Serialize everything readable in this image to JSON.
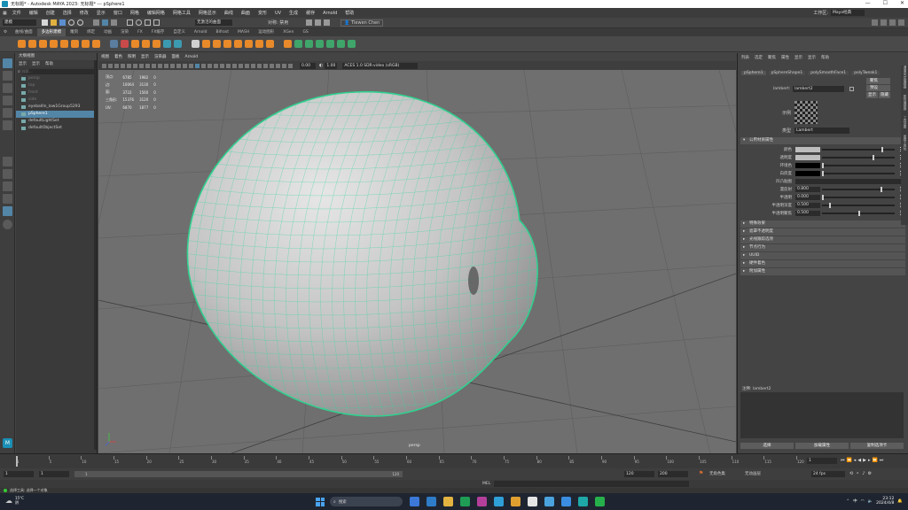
{
  "window": {
    "title": "无标题* - Autodesk MAYA 2023: 无标题* --- pSphere1",
    "controls": [
      "—",
      "☐",
      "✕"
    ]
  },
  "menubar": {
    "items": [
      "文件",
      "编辑",
      "创建",
      "选择",
      "修改",
      "显示",
      "窗口",
      "网格",
      "编辑网格",
      "网格工具",
      "网格显示",
      "曲线",
      "曲面",
      "变形",
      "UV",
      "生成",
      "缓存",
      "Arnold",
      "帮助"
    ],
    "workspace_label": "工作区:",
    "workspace_value": "Maya经典"
  },
  "statusline": {
    "mode": "建模",
    "no_live": "无激活的曲面",
    "symmetry": "对称: 禁用",
    "user": "Tiewen Chen"
  },
  "shelf": {
    "tabs": [
      "曲线/曲面",
      "多边形建模",
      "雕刻",
      "绑定",
      "动画",
      "渲染",
      "FX",
      "FX缓存",
      "自定义",
      "Arnold",
      "Bifrost",
      "MASH",
      "运动图形",
      "XGen",
      "GS"
    ],
    "active_tab": 1,
    "colors": [
      "#e8892a",
      "#e8892a",
      "#e8892a",
      "#e8892a",
      "#e8892a",
      "#e8892a",
      "#e8892a",
      "#e8892a",
      "#5a7da0",
      "#c94a4a",
      "#e8892a",
      "#e8892a",
      "#e8892a",
      "#3c9ab0",
      "#3c9ab0",
      "#d0d0d0",
      "#e8892a",
      "#e8892a",
      "#e8892a",
      "#e8892a",
      "#e8892a",
      "#e8892a",
      "#e8892a",
      "#e8892a",
      "#3fa56a",
      "#3fa56a",
      "#3fa56a",
      "#3fa56a",
      "#3fa56a",
      "#3fa56a"
    ]
  },
  "outliner": {
    "title": "大纲视图",
    "menu": [
      "显示",
      "显示",
      "帮助"
    ],
    "search_placeholder": "搜索...",
    "items": [
      {
        "label": "persp",
        "state": "dim"
      },
      {
        "label": "top",
        "state": "dim"
      },
      {
        "label": "front",
        "state": "dim"
      },
      {
        "label": "side",
        "state": "dim"
      },
      {
        "label": "eyeballIn_low1Group5293",
        "state": "normal"
      },
      {
        "label": "pSphere1",
        "state": "selected"
      },
      {
        "label": "defaultLightSet",
        "state": "normal"
      },
      {
        "label": "defaultObjectSet",
        "state": "normal"
      }
    ]
  },
  "viewport": {
    "menu": [
      "视图",
      "着色",
      "照明",
      "显示",
      "渲染器",
      "面板",
      "Arnold"
    ],
    "field_a": "0.00",
    "field_b": "1.00",
    "colorspace": "ACES 1.0 SDR-video (sRGB)",
    "camera_label": "persp",
    "hud": {
      "rows": [
        {
          "label": "顶点:",
          "v1": "6785",
          "v2": "1982",
          "v3": "0"
        },
        {
          "label": "边:",
          "v1": "10064",
          "v2": "3130",
          "v3": "0"
        },
        {
          "label": "面:",
          "v1": "3722",
          "v2": "1560",
          "v3": "0"
        },
        {
          "label": "三角形:",
          "v1": "15376",
          "v2": "3120",
          "v3": "0"
        },
        {
          "label": "UV:",
          "v1": "6870",
          "v2": "1877",
          "v3": "0"
        }
      ]
    }
  },
  "attribute_editor": {
    "menu": [
      "列表",
      "选定",
      "聚焦",
      "属性",
      "显示",
      "显示",
      "帮助"
    ],
    "tabs": [
      "pSphere1",
      "pSphereShape1",
      "polySmoothFace1",
      "polyTweak1"
    ],
    "node_label": "lambert:",
    "node_value": "lambert2",
    "buttons": [
      "聚焦",
      "预设",
      "显示",
      "隐藏"
    ],
    "sample_label": "示例",
    "type_label": "类型",
    "type_value": "Lambert",
    "section_open": "公用材质属性",
    "attrs": [
      {
        "label": "颜色",
        "kind": "swatch",
        "color": "#bdbdbd",
        "slider": 0.82
      },
      {
        "label": "透明度",
        "kind": "swatch",
        "color": "#bdbdbd",
        "slider": 0.7
      },
      {
        "label": "环境色",
        "kind": "swatch",
        "color": "#000000",
        "slider": 0.0
      },
      {
        "label": "白炽度",
        "kind": "swatch",
        "color": "#000000",
        "slider": 0.0
      },
      {
        "label": "凹凸贴图",
        "kind": "empty"
      },
      {
        "label": "漫反射",
        "kind": "value",
        "value": "0.800",
        "slider": 0.8
      },
      {
        "label": "半透明",
        "kind": "value",
        "value": "0.000",
        "slider": 0.0
      },
      {
        "label": "半透明深度",
        "kind": "value",
        "value": "0.500",
        "slider": 0.1
      },
      {
        "label": "半透明聚焦",
        "kind": "value",
        "value": "0.500",
        "slider": 0.5
      }
    ],
    "sections": [
      "特殊效果",
      "遮罩不透明度",
      "光线跟踪选项",
      "节点行为",
      "UUID",
      "硬件着色",
      "附加属性"
    ],
    "notes_label": "注释: lambert2",
    "bottom_buttons": [
      "选择",
      "加载属性",
      "复制选项卡"
    ],
    "side_tabs": [
      "通道盒/层编辑器",
      "属性编辑器",
      "工具设置",
      "建模工具包"
    ]
  },
  "timeline": {
    "ticks": [
      "1",
      "5",
      "10",
      "15",
      "20",
      "25",
      "30",
      "35",
      "40",
      "45",
      "50",
      "55",
      "60",
      "65",
      "70",
      "75",
      "80",
      "85",
      "90",
      "95",
      "100",
      "105",
      "110",
      "115",
      "120"
    ],
    "current_frame": "1"
  },
  "range": {
    "start": "1",
    "start2": "1",
    "range_start_inner": "1",
    "range_end_inner": "120",
    "end": "120",
    "end2": "200",
    "char_set": "无角色集",
    "anim_layer": "无动画层",
    "fps": "24 fps"
  },
  "cmdline": {
    "lang": "MEL"
  },
  "helpline": {
    "text": "选择工具: 选择一个对象"
  },
  "taskbar": {
    "weather_temp": "15°C",
    "weather_desc": "阴",
    "search_placeholder": "搜索",
    "time": "23:12",
    "date": "2024/4/8",
    "lang": "中",
    "icon_colors": [
      "#3b78d8",
      "#2f7cc8",
      "#e3b341",
      "#1f9d55",
      "#b33f9b",
      "#2f9fd8",
      "#e0a030",
      "#e5e5e5",
      "#4aa3df",
      "#3a8de0",
      "#1ea8a8",
      "#26b04b"
    ]
  }
}
